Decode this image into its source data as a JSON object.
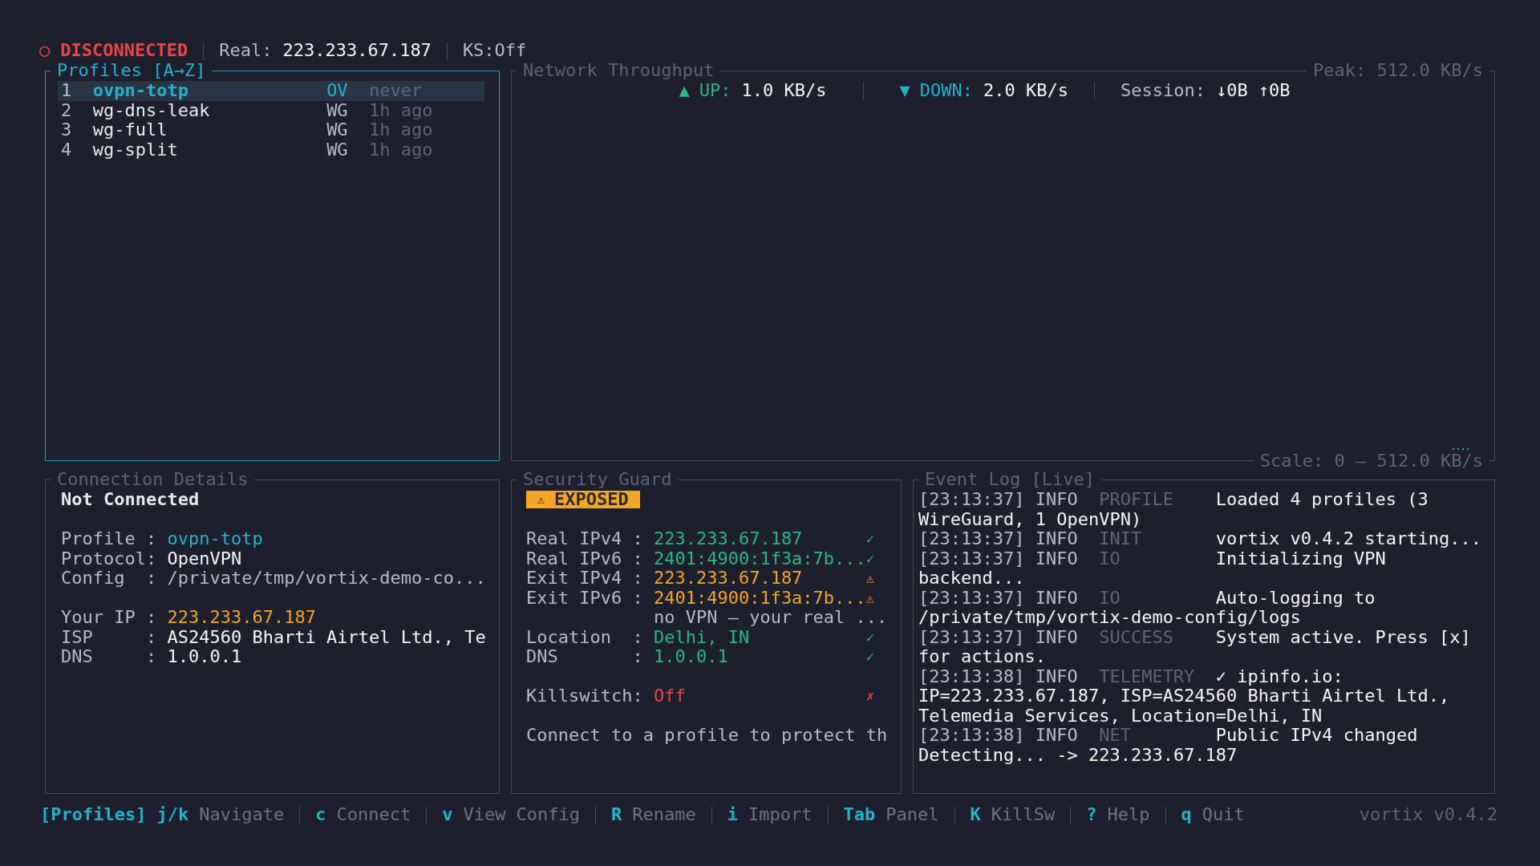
{
  "top_bar": {
    "indicator": "○",
    "state": "DISCONNECTED",
    "connected": false,
    "real_label": "Real:",
    "real_ip": "223.233.67.187",
    "killswitch": "KS:Off"
  },
  "profiles": {
    "title": "Profiles [A→Z]",
    "focused": true,
    "items": [
      {
        "index": "1",
        "name": "ovpn-totp",
        "type": "OV",
        "last_used": "never",
        "selected": true
      },
      {
        "index": "2",
        "name": "wg-dns-leak",
        "type": "WG",
        "last_used": "1h ago",
        "selected": false
      },
      {
        "index": "3",
        "name": "wg-full",
        "type": "WG",
        "last_used": "1h ago",
        "selected": false
      },
      {
        "index": "4",
        "name": "wg-split",
        "type": "WG",
        "last_used": "1h ago",
        "selected": false
      }
    ]
  },
  "throughput": {
    "title": "Network Throughput",
    "focused": false,
    "peak": "Peak: 512.0 KB/s",
    "up_arrow": "▲",
    "up_label": "UP:",
    "up_value": "1.0 KB/s",
    "down_arrow": "▼",
    "down_label": "DOWN:",
    "down_value": "2.0 KB/s",
    "session_label": "Session:",
    "session_down": "↓0B",
    "session_up": "↑0B",
    "scale": "Scale: 0 — 512.0 KB/s"
  },
  "connection": {
    "title": "Connection Details",
    "focused": false,
    "status": "Not Connected",
    "groups": [
      [
        {
          "label": "Profile :",
          "value": "ovpn-totp",
          "color": "#22b3cc"
        },
        {
          "label": "Protocol:",
          "value": "OpenVPN",
          "color": "#f4f4f6"
        },
        {
          "label": "Config  :",
          "value": "/private/tmp/vortix-demo-co...",
          "color": "#b3bace"
        }
      ],
      [
        {
          "label": "Your IP :",
          "value": "223.233.67.187",
          "color": "#f5a524"
        },
        {
          "label": "ISP     :",
          "value": "AS24560 Bharti Airtel Ltd., Te",
          "color": "#f4f4f6"
        },
        {
          "label": "DNS     :",
          "value": "1.0.0.1",
          "color": "#f4f4f6"
        }
      ]
    ]
  },
  "security": {
    "title": "Security Guard",
    "focused": false,
    "badge_icon": "⚠",
    "badge": "EXPOSED",
    "rows": [
      {
        "kind": "field",
        "label": "Real IPv4 :",
        "value": "223.233.67.187",
        "color": "#27b882",
        "mark": "✓"
      },
      {
        "kind": "field",
        "label": "Real IPv6 :",
        "value": "2401:4900:1f3a:7b...",
        "color": "#27b882",
        "mark": "✓"
      },
      {
        "kind": "field",
        "label": "Exit IPv4 :",
        "value": "223.233.67.187",
        "color": "#f5a524",
        "mark": "⚠"
      },
      {
        "kind": "field",
        "label": "Exit IPv6 :",
        "value": "2401:4900:1f3a:7b...",
        "color": "#f5a524",
        "mark": "⚠"
      },
      {
        "kind": "note",
        "value": "no VPN — your real ..."
      },
      {
        "kind": "field",
        "label": "Location  :",
        "value": "Delhi, IN",
        "color": "#27b882",
        "mark": "✓"
      },
      {
        "kind": "field",
        "label": "DNS       :",
        "value": "1.0.0.1",
        "color": "#27b882",
        "mark": "✓"
      },
      {
        "kind": "spacer"
      },
      {
        "kind": "field",
        "label": "Killswitch:",
        "value": "Off",
        "color": "#ef4444",
        "mark": "✗"
      },
      {
        "kind": "spacer"
      },
      {
        "kind": "note_left",
        "value": "Connect to a profile to protect th"
      }
    ]
  },
  "event_log": {
    "title": "Event Log [Live]",
    "focused": false,
    "entries": [
      {
        "time": "[23:13:37]",
        "level": "INFO",
        "source": "PROFILE",
        "message": "Loaded 4 profiles (3 WireGuard, 1 OpenVPN)"
      },
      {
        "time": "[23:13:37]",
        "level": "INFO",
        "source": "INIT",
        "message": "vortix v0.4.2 starting..."
      },
      {
        "time": "[23:13:37]",
        "level": "INFO",
        "source": "IO",
        "message": "Initializing VPN backend..."
      },
      {
        "time": "[23:13:37]",
        "level": "INFO",
        "source": "IO",
        "message": "Auto-logging to /private/tmp/vortix-demo-config/logs"
      },
      {
        "time": "[23:13:37]",
        "level": "INFO",
        "source": "SUCCESS",
        "message": "System active. Press [x] for actions."
      },
      {
        "time": "[23:13:38]",
        "level": "INFO",
        "source": "TELEMETRY",
        "message": "✓ ipinfo.io: IP=223.233.67.187, ISP=AS24560 Bharti Airtel Ltd., Telemedia Services, Location=Delhi, IN"
      },
      {
        "time": "[23:13:38]",
        "level": "INFO",
        "source": "NET",
        "message": "Public IPv4 changed Detecting... -> 223.233.67.187"
      }
    ]
  },
  "footer": {
    "mode": "[Profiles]",
    "hints": [
      {
        "key": "j/k",
        "action": "Navigate"
      },
      {
        "key": "c",
        "action": "Connect"
      },
      {
        "key": "v",
        "action": "View Config"
      },
      {
        "key": "R",
        "action": "Rename"
      },
      {
        "key": "i",
        "action": "Import"
      },
      {
        "key": "Tab",
        "action": "Panel"
      },
      {
        "key": "K",
        "action": "KillSw"
      },
      {
        "key": "?",
        "action": "Help"
      },
      {
        "key": "q",
        "action": "Quit"
      }
    ],
    "version": "vortix v0.4.2"
  }
}
